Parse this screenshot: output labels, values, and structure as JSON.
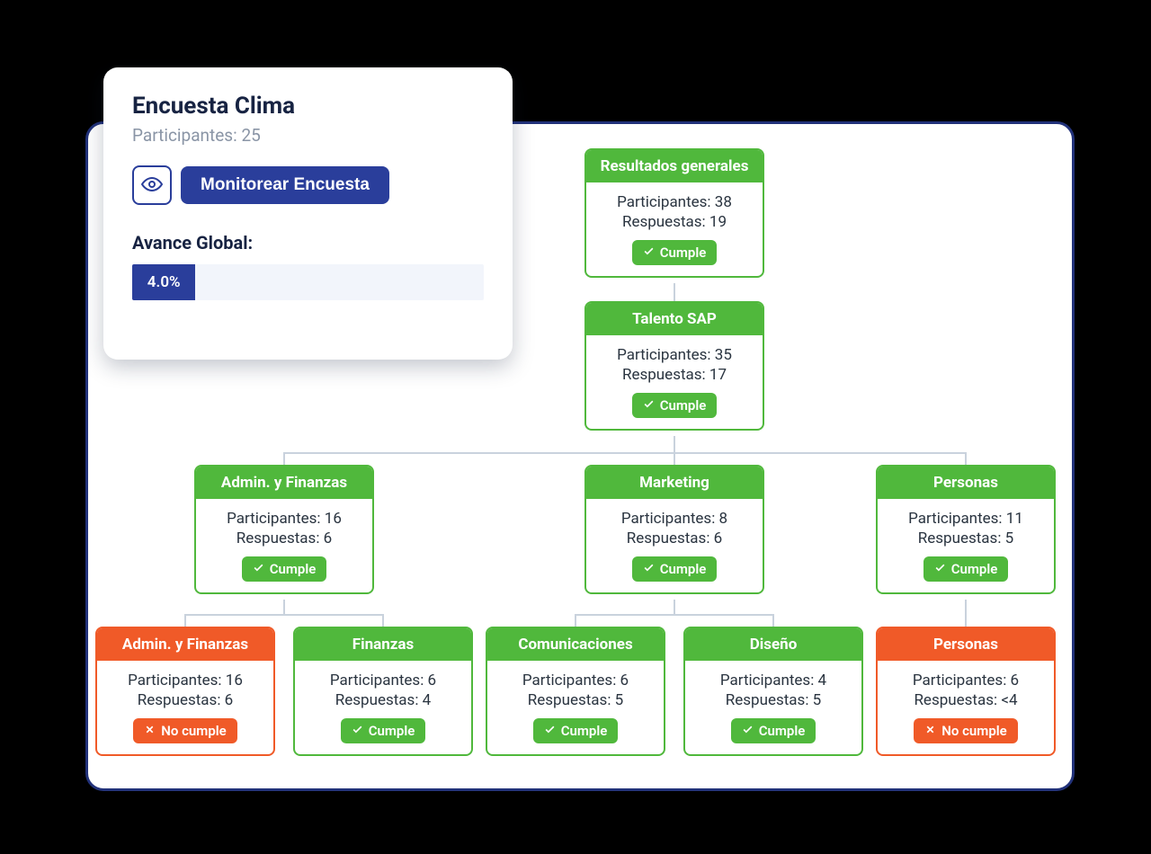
{
  "card": {
    "title": "Encuesta Clima",
    "participants_label": "Participantes:",
    "participants_value": "25",
    "monitor_label": "Monitorear Encuesta",
    "avance_label": "Avance Global:",
    "progress_pct": "4.0%",
    "progress_width": "18%"
  },
  "labels": {
    "part": "Participantes:",
    "resp": "Respuestas:",
    "ok": "Cumple",
    "no": "No cumple"
  },
  "nodes": {
    "root": {
      "title": "Resultados generales",
      "participants": "38",
      "responses": "19",
      "status": "ok"
    },
    "talento": {
      "title": "Talento SAP",
      "participants": "35",
      "responses": "17",
      "status": "ok"
    },
    "adminfin": {
      "title": "Admin. y Finanzas",
      "participants": "16",
      "responses": "6",
      "status": "ok"
    },
    "marketing": {
      "title": "Marketing",
      "participants": "8",
      "responses": "6",
      "status": "ok"
    },
    "personas": {
      "title": "Personas",
      "participants": "11",
      "responses": "5",
      "status": "ok"
    },
    "adminfin2": {
      "title": "Admin. y Finanzas",
      "participants": "16",
      "responses": "6",
      "status": "no"
    },
    "finanzas": {
      "title": "Finanzas",
      "participants": "6",
      "responses": "4",
      "status": "ok"
    },
    "comunicaciones": {
      "title": "Comunicaciones",
      "participants": "6",
      "responses": "5",
      "status": "ok"
    },
    "diseno": {
      "title": "Diseño",
      "participants": "4",
      "responses": "5",
      "status": "ok"
    },
    "personas2": {
      "title": "Personas",
      "participants": "6",
      "responses": "<4",
      "status": "no"
    }
  }
}
